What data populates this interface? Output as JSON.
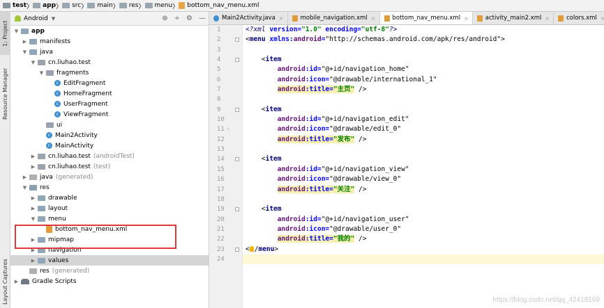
{
  "breadcrumb": [
    "test",
    "app",
    "src",
    "main",
    "res",
    "menu",
    "bottom_nav_menu.xml"
  ],
  "side_tabs": {
    "project": "1: Project",
    "resource_manager": "Resource Manager",
    "layout_captures": "Layout Captures"
  },
  "panel": {
    "view_label": "Android"
  },
  "tree": [
    {
      "label": "app",
      "gray": "",
      "indent": 0,
      "arrow": "▼",
      "icon": "folder",
      "bold": true
    },
    {
      "label": "manifests",
      "gray": "",
      "indent": 1,
      "arrow": "▶",
      "icon": "folder"
    },
    {
      "label": "java",
      "gray": "",
      "indent": 1,
      "arrow": "▼",
      "icon": "folder"
    },
    {
      "label": "cn.liuhao.test",
      "gray": "",
      "indent": 2,
      "arrow": "▼",
      "icon": "package"
    },
    {
      "label": "fragments",
      "gray": "",
      "indent": 3,
      "arrow": "▼",
      "icon": "package"
    },
    {
      "label": "EditFragment",
      "gray": "",
      "indent": 4,
      "arrow": "",
      "icon": "class"
    },
    {
      "label": "HomeFragment",
      "gray": "",
      "indent": 4,
      "arrow": "",
      "icon": "class"
    },
    {
      "label": "UserFragment",
      "gray": "",
      "indent": 4,
      "arrow": "",
      "icon": "class"
    },
    {
      "label": "ViewFragment",
      "gray": "",
      "indent": 4,
      "arrow": "",
      "icon": "class"
    },
    {
      "label": "ui",
      "gray": "",
      "indent": 3,
      "arrow": "",
      "icon": "package"
    },
    {
      "label": "Main2Activity",
      "gray": "",
      "indent": 3,
      "arrow": "",
      "icon": "class"
    },
    {
      "label": "MainActivity",
      "gray": "",
      "indent": 3,
      "arrow": "",
      "icon": "class"
    },
    {
      "label": "cn.liuhao.test",
      "gray": "(androidTest)",
      "indent": 2,
      "arrow": "▶",
      "icon": "package"
    },
    {
      "label": "cn.liuhao.test",
      "gray": "(test)",
      "indent": 2,
      "arrow": "▶",
      "icon": "package"
    },
    {
      "label": "java",
      "gray": "(generated)",
      "indent": 1,
      "arrow": "▶",
      "icon": "folder-gen"
    },
    {
      "label": "res",
      "gray": "",
      "indent": 1,
      "arrow": "▼",
      "icon": "folder-res"
    },
    {
      "label": "drawable",
      "gray": "",
      "indent": 2,
      "arrow": "▶",
      "icon": "folder"
    },
    {
      "label": "layout",
      "gray": "",
      "indent": 2,
      "arrow": "▶",
      "icon": "folder"
    },
    {
      "label": "menu",
      "gray": "",
      "indent": 2,
      "arrow": "▼",
      "icon": "folder"
    },
    {
      "label": "bottom_nav_menu.xml",
      "gray": "",
      "indent": 3,
      "arrow": "",
      "icon": "xml"
    },
    {
      "label": "mipmap",
      "gray": "",
      "indent": 2,
      "arrow": "▶",
      "icon": "folder"
    },
    {
      "label": "navigation",
      "gray": "",
      "indent": 2,
      "arrow": "▶",
      "icon": "folder"
    },
    {
      "label": "values",
      "gray": "",
      "indent": 2,
      "arrow": "▶",
      "icon": "folder",
      "selected": true
    },
    {
      "label": "res",
      "gray": "(generated)",
      "indent": 1,
      "arrow": "",
      "icon": "folder-gen"
    },
    {
      "label": "Gradle Scripts",
      "gray": "",
      "indent": 0,
      "arrow": "▶",
      "icon": "gradle"
    }
  ],
  "tabs": [
    {
      "label": "Main2Activity.java",
      "type": "class",
      "active": false
    },
    {
      "label": "mobile_navigation.xml",
      "type": "xml",
      "active": false
    },
    {
      "label": "bottom_nav_menu.xml",
      "type": "xml",
      "active": true
    },
    {
      "label": "activity_main2.xml",
      "type": "xml",
      "active": false
    },
    {
      "label": "colors.xml",
      "type": "xml",
      "active": false
    }
  ],
  "code_lines": [
    "<?xml version=\"1.0\" encoding=\"utf-8\"?>",
    "<menu xmlns:android=\"http://schemas.android.com/apk/res/android\">",
    "",
    "    <item",
    "        android:id=\"@+id/navigation_home\"",
    "        android:icon=\"@drawable/international_1\"",
    "        android:title=\"主页\" />",
    "",
    "    <item",
    "        android:id=\"@+id/navigation_edit\"",
    "        android:icon=\"@drawable/edit_0\"",
    "        android:title=\"发布\" />",
    "",
    "    <item",
    "        android:id=\"@+id/navigation_view\"",
    "        android:icon=\"@drawable/view_0\"",
    "        android:title=\"关注\" />",
    "",
    "    <item",
    "        android:id=\"@+id/navigation_user\"",
    "        android:icon=\"@drawable/user_0\"",
    "        android:title=\"我的\" />",
    "</menu>",
    ""
  ],
  "current_line": 24,
  "watermark": "https://blog.csdn.net/qq_42418169"
}
